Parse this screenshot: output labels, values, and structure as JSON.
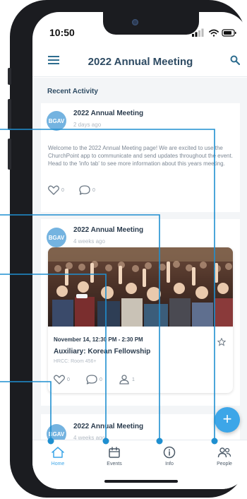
{
  "status_bar": {
    "time": "10:50"
  },
  "header": {
    "title": "2022 Annual Meeting"
  },
  "feed": {
    "section_title": "Recent Activity",
    "posts": [
      {
        "avatar": "BGAV",
        "title": "2022 Annual Meeting",
        "time": "2 days ago",
        "body": "Welcome to the 2022 Annual Meeting page! We are excited to use the ChurchPoint app to communicate and send updates throughout the event. Head to the 'info tab' to see more information about this years meeting.",
        "likes": "0",
        "comments": "0"
      },
      {
        "avatar": "BGAV",
        "title": "2022 Annual Meeting",
        "time": "4 weeks ago",
        "event": {
          "date": "November 14, 12:30 PM - 2:30 PM",
          "name": "Auxiliary: Korean Fellowship",
          "location": "HRCC: Room 456+",
          "likes": "0",
          "comments": "0",
          "attendees": "1"
        }
      },
      {
        "avatar": "BGAV",
        "title": "2022 Annual Meeting",
        "time": "4 weeks ago"
      }
    ]
  },
  "fab": {
    "label": "+"
  },
  "tabs": [
    {
      "label": "Home",
      "icon": "home-icon"
    },
    {
      "label": "Events",
      "icon": "calendar-icon"
    },
    {
      "label": "Info",
      "icon": "info-icon"
    },
    {
      "label": "People",
      "icon": "people-icon"
    }
  ],
  "colors": {
    "accent": "#3da6e8",
    "title": "#2e4b63",
    "avatar": "#74b3e0",
    "phone": "#1b1c20"
  }
}
